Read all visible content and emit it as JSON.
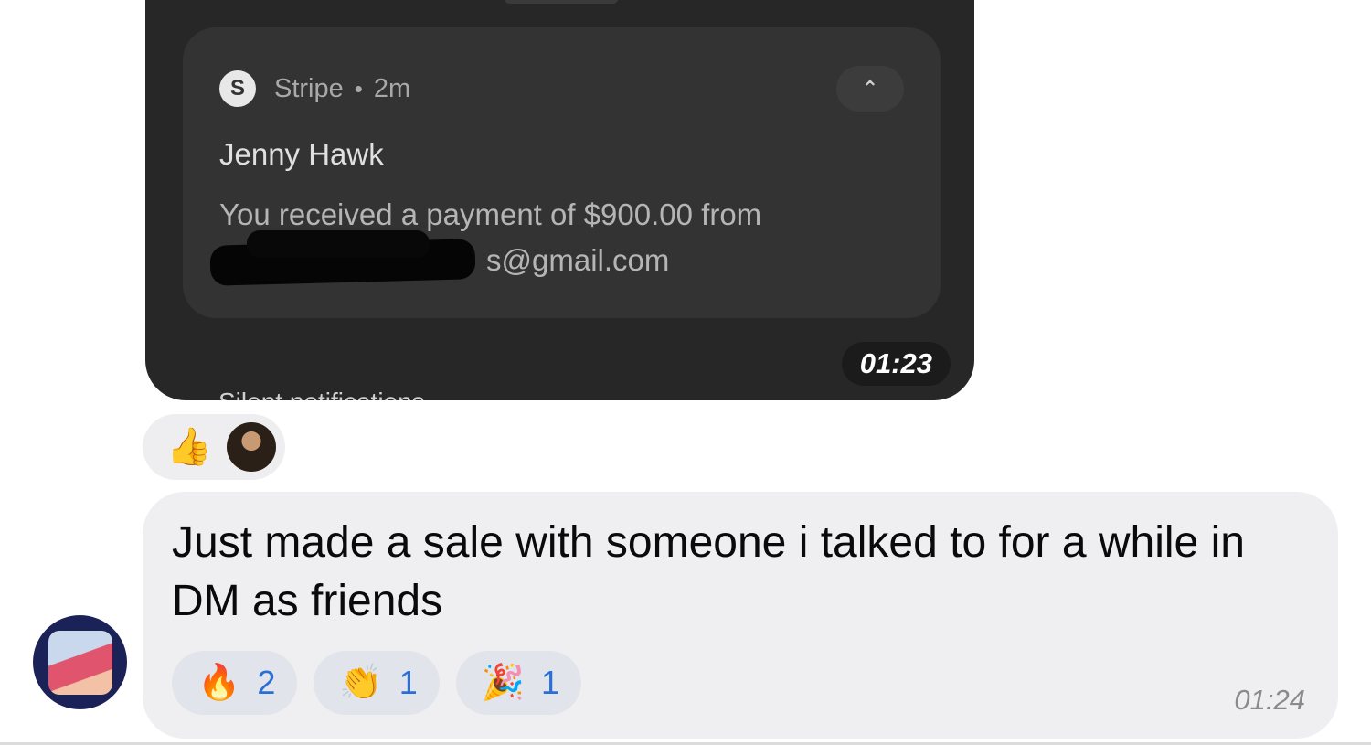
{
  "screenshot": {
    "notification": {
      "app_icon_letter": "S",
      "app_name": "Stripe",
      "separator": "•",
      "age": "2m",
      "collapse_icon": "chevron-up-icon",
      "title": "Jenny Hawk",
      "body_line1": "You received a payment of $900.00 from",
      "body_line2": "s@gmail.com"
    },
    "silent_label": "Silent notifications",
    "timestamp": "01:23"
  },
  "screenshot_reaction": {
    "emoji": "👍",
    "reactor_avatar": "avatar"
  },
  "message": {
    "text": "Just made a sale with someone i talked to for a while in DM as friends",
    "timestamp": "01:24",
    "reactions": [
      {
        "emoji": "🔥",
        "count": "2"
      },
      {
        "emoji": "👏",
        "count": "1"
      },
      {
        "emoji": "🎉",
        "count": "1"
      }
    ]
  },
  "colors": {
    "count_blue": "#2b6fd6",
    "bubble_bg": "#efeff2",
    "screenshot_bg": "#272727"
  }
}
